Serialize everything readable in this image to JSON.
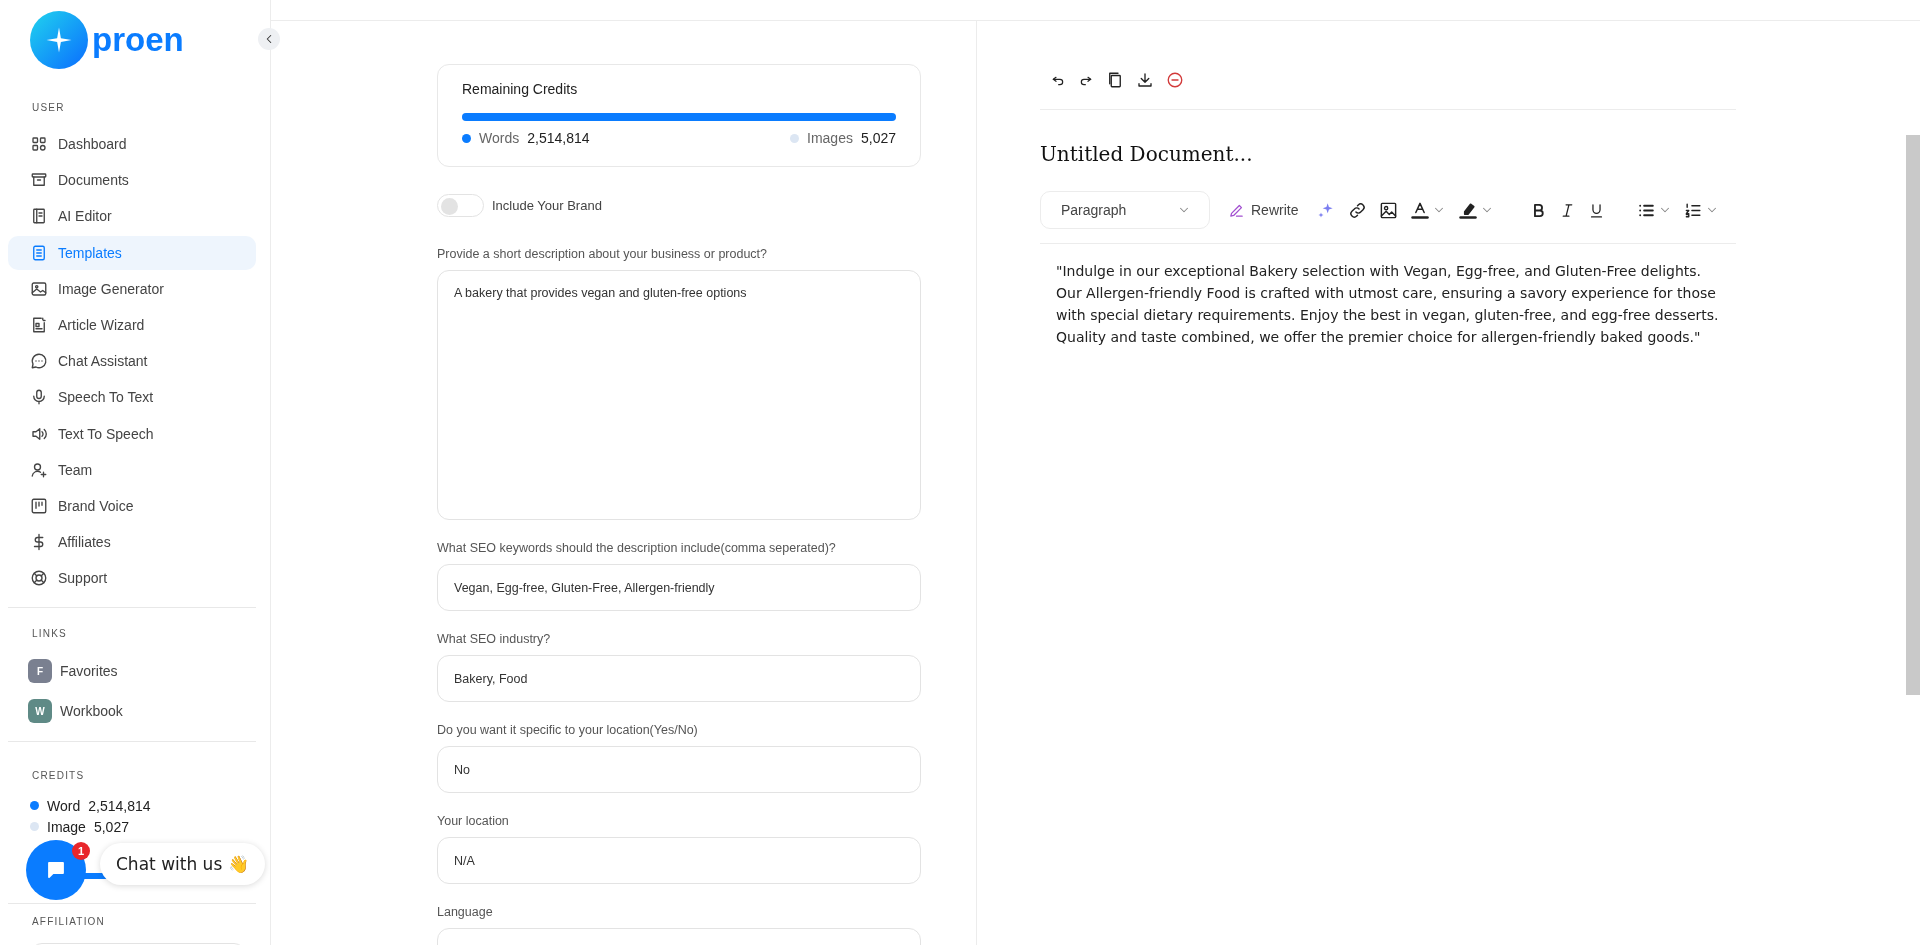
{
  "logo": {
    "text": "proen"
  },
  "sidebar": {
    "user": {
      "title": "USER",
      "items": [
        {
          "label": "Dashboard",
          "selected": false
        },
        {
          "label": "Documents",
          "selected": false
        },
        {
          "label": "AI Editor",
          "selected": false
        },
        {
          "label": "Templates",
          "selected": true
        },
        {
          "label": "Image Generator",
          "selected": false
        },
        {
          "label": "Article Wizard",
          "selected": false
        },
        {
          "label": "Chat Assistant",
          "selected": false
        },
        {
          "label": "Speech To Text",
          "selected": false
        },
        {
          "label": "Text To Speech",
          "selected": false
        },
        {
          "label": "Team",
          "selected": false
        },
        {
          "label": "Brand Voice",
          "selected": false
        },
        {
          "label": "Affiliates",
          "selected": false
        },
        {
          "label": "Support",
          "selected": false
        }
      ]
    },
    "links": {
      "title": "LINKS",
      "items": [
        {
          "initial": "F",
          "label": "Favorites",
          "color": "#7a8090"
        },
        {
          "initial": "W",
          "label": "Workbook",
          "color": "#5f8a86"
        }
      ]
    },
    "credits": {
      "title": "CREDITS",
      "level": 1,
      "items": [
        {
          "label": "Word",
          "value": "2,514,814",
          "color": "#0a7cff"
        },
        {
          "label": "Image",
          "value": "5,027",
          "color": "#dce6f3"
        }
      ]
    },
    "affiliation": {
      "title": "AFFILIATION"
    }
  },
  "chat_widget": {
    "badge": "1",
    "label": "Chat with us 👋"
  },
  "credits_card": {
    "title": "Remaining Credits",
    "level": 1,
    "items": [
      {
        "label": "Words",
        "value": "2,514,814",
        "color": "#0a7cff"
      },
      {
        "label": "Images",
        "value": "5,027",
        "color": "#dce6f3"
      }
    ]
  },
  "brand_toggle": {
    "label": "Include Your Brand",
    "on": false
  },
  "fields": [
    {
      "kind": "textarea",
      "label": "Provide a short description about your business or product?",
      "value": "A bakery that provides vegan and gluten-free options"
    },
    {
      "kind": "input",
      "label": "What SEO keywords should the description include(comma seperated)?",
      "value": "Vegan, Egg-free, Gluten-Free, Allergen-friendly"
    },
    {
      "kind": "input",
      "label": "What SEO industry?",
      "value": "Bakery, Food"
    },
    {
      "kind": "input",
      "label": "Do you want it specific to your location(Yes/No)",
      "value": "No"
    },
    {
      "kind": "input",
      "label": "Your location",
      "value": "N/A"
    },
    {
      "kind": "input",
      "label": "Language"
    }
  ],
  "editor": {
    "title": "Untitled Document...",
    "block_format": "Paragraph",
    "rewrite": "Rewrite",
    "body": "\"Indulge in our exceptional Bakery selection with Vegan, Egg-free, and Gluten-Free delights. Our Allergen-friendly Food is crafted with utmost care, ensuring a savory experience for those with special dietary requirements. Enjoy the best in vegan, gluten-free, and egg-free desserts. Quality and taste combined, we offer the premier choice for allergen-friendly baked goods.\""
  }
}
